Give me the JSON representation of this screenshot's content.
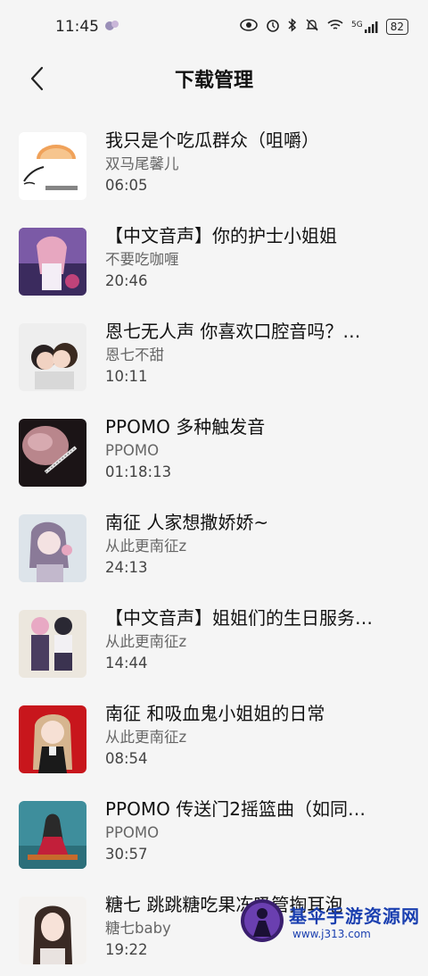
{
  "status_bar": {
    "time": "11:45",
    "network": "5G",
    "battery": "82"
  },
  "header": {
    "title": "下载管理"
  },
  "items": [
    {
      "title": "我只是个吃瓜群众（咀嚼）",
      "author": "双马尾馨儿",
      "duration": "06:05"
    },
    {
      "title": "【中文音声】你的护士小姐姐",
      "author": "不要吃咖喱",
      "duration": "20:46"
    },
    {
      "title": "恩七无人声 你喜欢口腔音吗？…",
      "author": "恩七不甜",
      "duration": "10:11"
    },
    {
      "title": "PPOMO 多种触发音",
      "author": "PPOMO",
      "duration": "01:18:13"
    },
    {
      "title": "南征 人家想撒娇娇~",
      "author": "从此更南征z",
      "duration": "24:13"
    },
    {
      "title": "【中文音声】姐姐们的生日服务…",
      "author": "从此更南征z",
      "duration": "14:44"
    },
    {
      "title": "南征 和吸血鬼小姐姐的日常",
      "author": "从此更南征z",
      "duration": "08:54"
    },
    {
      "title": "PPOMO 传送门2摇篮曲（如同…",
      "author": "PPOMO",
      "duration": "30:57"
    },
    {
      "title": "糖七 跳跳糖吃果冻吸管掏耳泡",
      "author": "糖七baby",
      "duration": "19:22"
    }
  ],
  "watermark": {
    "name": "基伞手游资源网",
    "url": "www.j313.com"
  }
}
